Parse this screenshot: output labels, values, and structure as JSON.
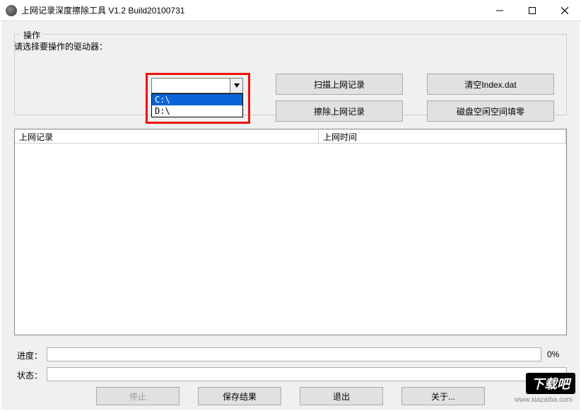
{
  "titlebar": {
    "title": "上网记录深度擦除工具 V1.2   Build20100731"
  },
  "group": {
    "legend": "操作",
    "drive_label": "请选择要操作的驱动器：",
    "combo_value": "",
    "options": [
      "C:\\",
      "D:\\"
    ],
    "selected_index": 0,
    "buttons": {
      "scan": "扫描上网记录",
      "wipe": "擦除上网记录",
      "clear_index": "清空Index.dat",
      "zero_free": "磁盘空闲空间填零"
    }
  },
  "listview": {
    "columns": {
      "record": "上网记录",
      "time": "上网时间"
    },
    "rows": []
  },
  "progress": {
    "label": "进度：",
    "percent_text": "0%"
  },
  "status": {
    "label": "状态：",
    "text": ""
  },
  "bottom": {
    "stop": "停止",
    "save": "保存结果",
    "exit": "退出",
    "about": "关于..."
  },
  "watermark": {
    "logo": "下载吧",
    "url": "www.xiazaiba.com"
  }
}
